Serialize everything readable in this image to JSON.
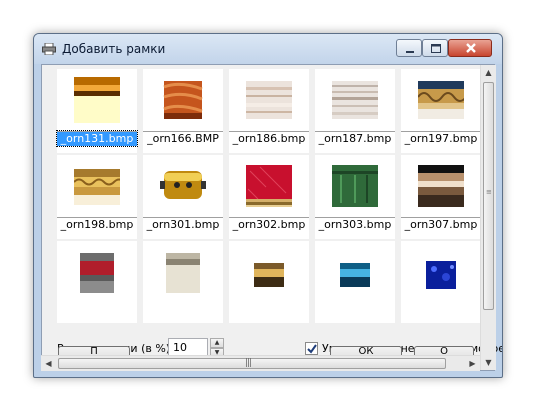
{
  "window": {
    "title": "Добавить рамки"
  },
  "thumbnails": [
    {
      "name": "_orn131.bmp",
      "selected": true
    },
    {
      "name": "_orn166.BMP",
      "selected": false
    },
    {
      "name": "_orn186.bmp",
      "selected": false
    },
    {
      "name": "_orn187.bmp",
      "selected": false
    },
    {
      "name": "_orn197.bmp",
      "selected": false
    },
    {
      "name": "_orn198.bmp",
      "selected": false
    },
    {
      "name": "_orn301.bmp",
      "selected": false
    },
    {
      "name": "_orn302.bmp",
      "selected": false
    },
    {
      "name": "_orn303.bmp",
      "selected": false
    },
    {
      "name": "_orn307.bmp",
      "selected": false
    }
  ],
  "options": {
    "size_label": "Размер рамки (в %)",
    "size_value": "10",
    "fit_label": "Умещать в окне при просмотре",
    "fit_checked": true
  },
  "buttons": {
    "left_label": "П",
    "ok_label": "ОК",
    "right_label": "О"
  }
}
